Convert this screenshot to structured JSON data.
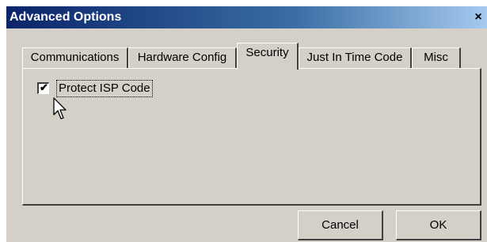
{
  "window": {
    "title": "Advanced Options",
    "close_glyph": "×"
  },
  "tabs": [
    {
      "label": "Communications",
      "active": false
    },
    {
      "label": "Hardware Config",
      "active": false
    },
    {
      "label": "Security",
      "active": true
    },
    {
      "label": "Just In Time Code",
      "active": false
    },
    {
      "label": "Misc",
      "active": false
    }
  ],
  "security": {
    "protect_isp_code": {
      "label": "Protect ISP Code",
      "checked": true,
      "check_glyph": "✔"
    }
  },
  "buttons": {
    "cancel": "Cancel",
    "ok": "OK"
  }
}
